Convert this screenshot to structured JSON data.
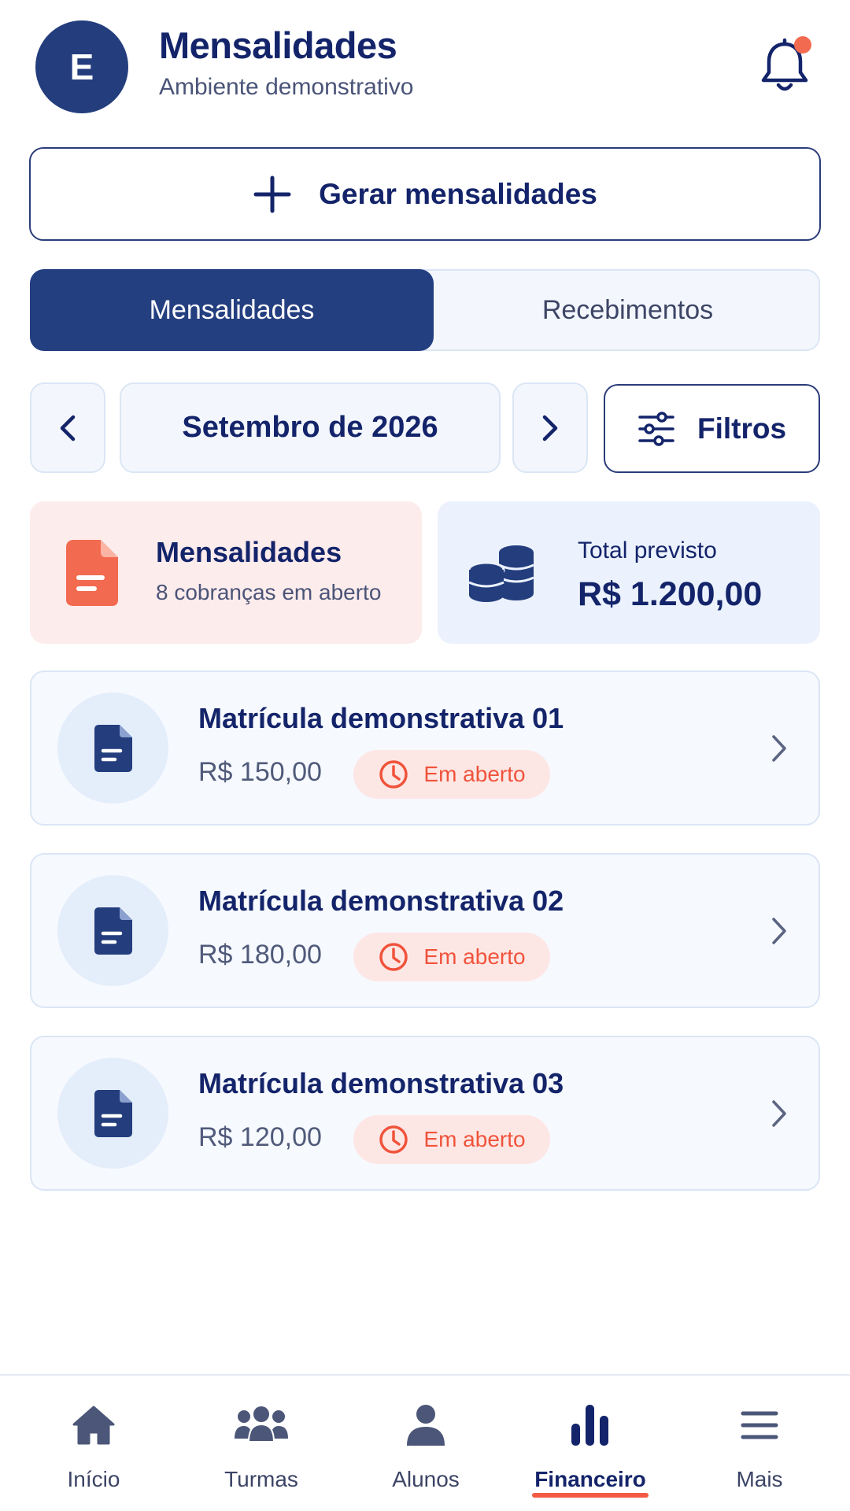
{
  "header": {
    "avatar_letter": "E",
    "title": "Mensalidades",
    "subtitle": "Ambiente demonstrativo",
    "notification_dot": true
  },
  "actions": {
    "generate_label": "Gerar mensalidades"
  },
  "segments": {
    "tabs": [
      {
        "label": "Mensalidades",
        "active": true
      },
      {
        "label": "Recebimentos",
        "active": false
      }
    ]
  },
  "period": {
    "label": "Setembro de 2026",
    "filters_label": "Filtros"
  },
  "summary": {
    "charges": {
      "title": "Mensalidades",
      "subtitle": "8 cobranças em aberto"
    },
    "total": {
      "label": "Total previsto",
      "value": "R$ 1.200,00"
    }
  },
  "items": [
    {
      "name": "Matrícula demonstrativa 01",
      "amount": "R$ 150,00",
      "status": "Em aberto"
    },
    {
      "name": "Matrícula demonstrativa 02",
      "amount": "R$ 180,00",
      "status": "Em aberto"
    },
    {
      "name": "Matrícula demonstrativa 03",
      "amount": "R$ 120,00",
      "status": "Em aberto"
    }
  ],
  "nav": {
    "items": [
      {
        "label": "Início",
        "icon": "home-icon"
      },
      {
        "label": "Turmas",
        "icon": "group-icon"
      },
      {
        "label": "Alunos",
        "icon": "person-icon"
      },
      {
        "label": "Financeiro",
        "icon": "bar-chart-icon",
        "active": true
      },
      {
        "label": "Mais",
        "icon": "menu-icon"
      }
    ]
  },
  "colors": {
    "primary": "#243f80",
    "accent": "#f25a44",
    "text": "#14246a"
  }
}
